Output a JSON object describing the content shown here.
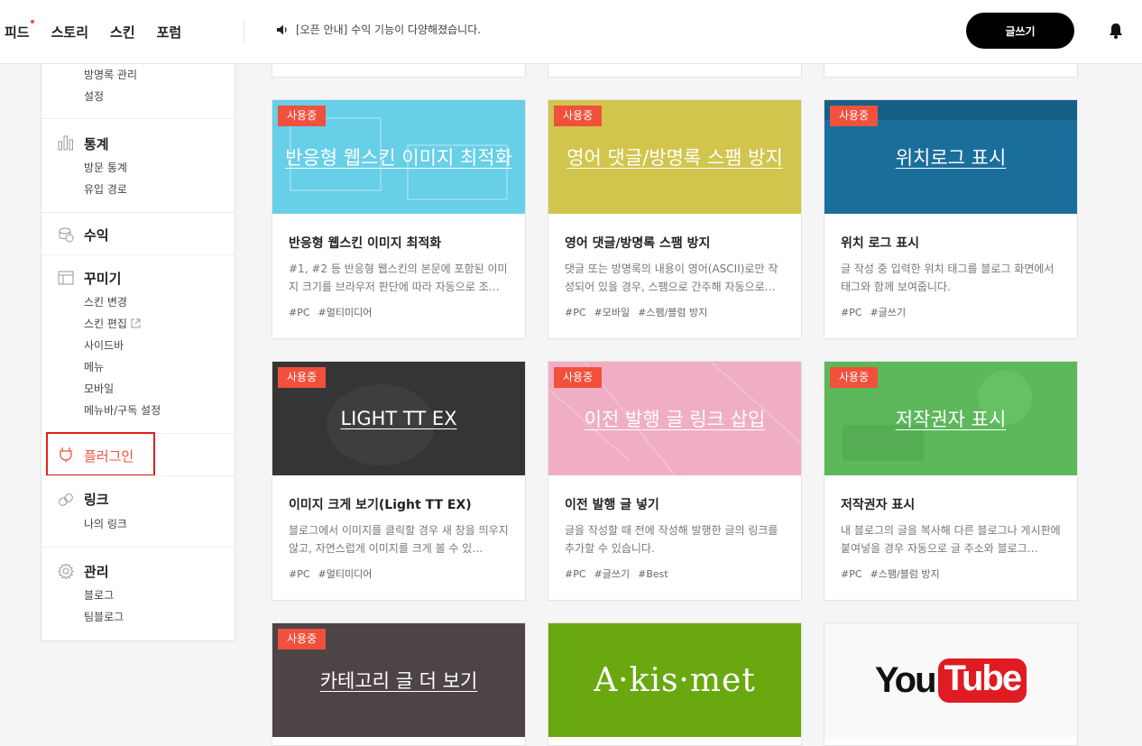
{
  "header": {
    "nav": [
      {
        "label": "피드",
        "new": true
      },
      {
        "label": "스토리",
        "new": false
      },
      {
        "label": "스킨",
        "new": false
      },
      {
        "label": "포럼",
        "new": false
      }
    ],
    "notice": "[오픈 안내] 수익 기능이 다양해졌습니다.",
    "write_label": "글쓰기"
  },
  "sidebar": {
    "top_items": [
      "방명록 관리",
      "설정"
    ],
    "stats": {
      "title": "통계",
      "items": [
        "방문 통계",
        "유입 경로"
      ]
    },
    "revenue": {
      "title": "수익"
    },
    "decorate": {
      "title": "꾸미기",
      "items": [
        "스킨 변경",
        "스킨 편집",
        "사이드바",
        "메뉴",
        "모바일",
        "메뉴바/구독 설정"
      ]
    },
    "plugin": {
      "title": "플러그인"
    },
    "link": {
      "title": "링크",
      "items": [
        "나의 링크"
      ]
    },
    "manage": {
      "title": "관리",
      "items": [
        "블로그",
        "팀블로그"
      ]
    }
  },
  "badge_label": "사용중",
  "cards": [
    {
      "banner": "반응형 웹스킨 이미지 최적화",
      "title": "반응형 웹스킨 이미지 최적화",
      "desc": "#1, #2 등 반응형 웹스킨의 본문에 포함된 이미지 크기를 브라우저 판단에 따라 자동으로 조…",
      "tags": [
        "#PC",
        "#멀티미디어"
      ],
      "color": "#67cfe8"
    },
    {
      "banner": "영어 댓글/방명록 스팸 방지",
      "title": "영어 댓글/방명록 스팸 방지",
      "desc": "댓글 또는 방명록의 내용이 영어(ASCII)로만 작성되어 있을 경우, 스팸으로 간주해 자동으로…",
      "tags": [
        "#PC",
        "#모바일",
        "#스팸/블럼 방지"
      ],
      "color": "#d2c54d"
    },
    {
      "banner": "위치로그 표시",
      "title": "위치 로그 표시",
      "desc": "글 작성 중 입력한 위치 태그를 블로그 화면에서 태그와 함께 보여줍니다.",
      "tags": [
        "#PC",
        "#글쓰기"
      ],
      "color": "#1a6e9c"
    },
    {
      "banner": "LIGHT TT EX",
      "title": "이미지 크게 보기(Light TT EX)",
      "desc": "블로그에서 이미지를 클릭할 경우 새 창을 띄우지 않고, 자연스럽게 이미지를 크게 볼 수 있…",
      "tags": [
        "#PC",
        "#멀티미디어"
      ],
      "color": "#353535"
    },
    {
      "banner": "이전 발행 글 링크 삽입",
      "title": "이전 발행 글 넣기",
      "desc": "글을 작성할 때 전에 작성해 발행한 글의 링크를 추가할 수 있습니다.",
      "tags": [
        "#PC",
        "#글쓰기",
        "#Best"
      ],
      "color": "#f0aec5"
    },
    {
      "banner": "저작권자 표시",
      "title": "저작권자 표시",
      "desc": "내 블로그의 글을 복사해 다른 블로그나 게시판에 붙여넣을 경우 자동으로 글 주소와 블로그…",
      "tags": [
        "#PC",
        "#스팸/블럼 방지"
      ],
      "color": "#5cb85a"
    },
    {
      "banner": "카테고리 글 더 보기",
      "color": "#4d4445"
    },
    {
      "banner": "A·kis·met",
      "color": "#6aa810"
    },
    {
      "banner_you": "You",
      "banner_tube": "Tube",
      "color": "#f9f9f9"
    }
  ]
}
